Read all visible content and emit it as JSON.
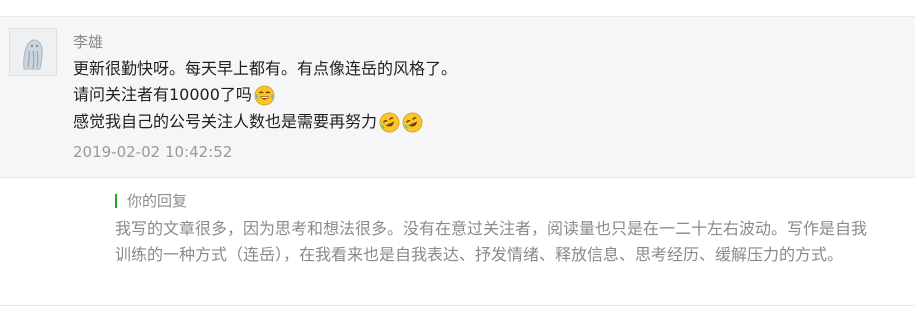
{
  "comment": {
    "author": "李雄",
    "lines": [
      {
        "text": "更新很勤快呀。每天早上都有。有点像连岳的风格了。",
        "emoji": []
      },
      {
        "text": "请问关注者有10000了吗",
        "emoji": [
          "tears-of-joy-emoji"
        ]
      },
      {
        "text": "感觉我自己的公号关注人数也是需要再努力",
        "emoji": [
          "rolling-laughing-emoji",
          "rolling-laughing-emoji"
        ]
      }
    ],
    "timestamp": "2019-02-02 10:42:52"
  },
  "reply": {
    "label": "你的回复",
    "text": "我写的文章很多，因为思考和想法很多。没有在意过关注者，阅读量也只是在一二十左右波动。写作是自我训练的一种方式（连岳），在我看来也是自我表达、抒发情绪、释放信息、思考经历、缓解压力的方式。"
  },
  "colors": {
    "card_background": "#f5f6f7",
    "reply_accent": "#1aad19",
    "secondary_text": "#8a8a8a"
  }
}
